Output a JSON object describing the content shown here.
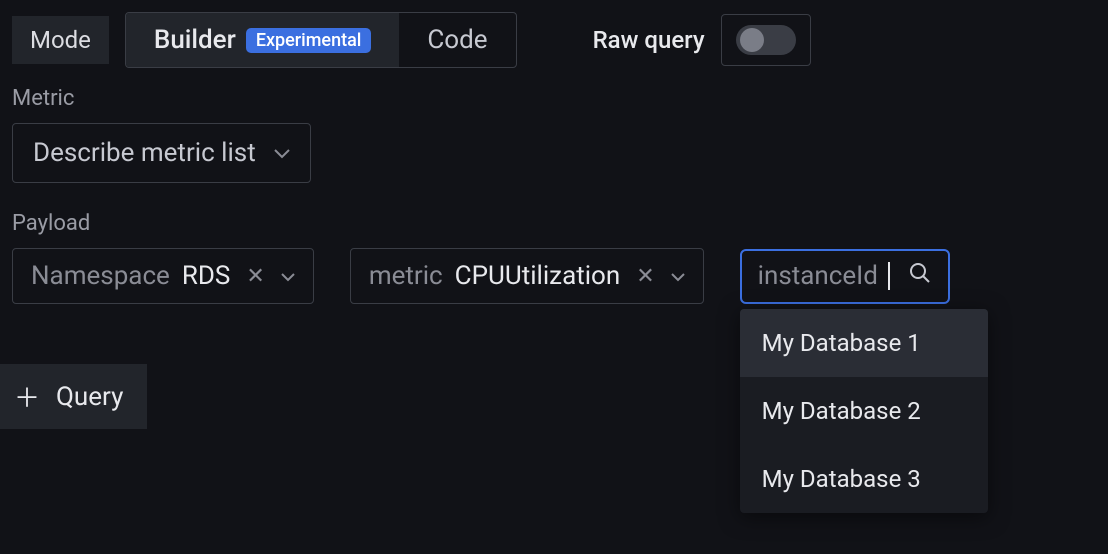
{
  "mode": {
    "label": "Mode",
    "tabs": {
      "builder": "Builder",
      "builder_badge": "Experimental",
      "code": "Code"
    }
  },
  "raw_query": {
    "label": "Raw query"
  },
  "metric": {
    "label": "Metric",
    "select_value": "Describe metric list"
  },
  "payload": {
    "label": "Payload",
    "chips": [
      {
        "key": "Namespace",
        "val": "RDS"
      },
      {
        "key": "metric",
        "val": "CPUUtilization"
      }
    ],
    "search": {
      "text": "instanceId"
    },
    "dropdown": [
      "My Database 1",
      "My Database 2",
      "My Database 3"
    ]
  },
  "add_query": "Query"
}
